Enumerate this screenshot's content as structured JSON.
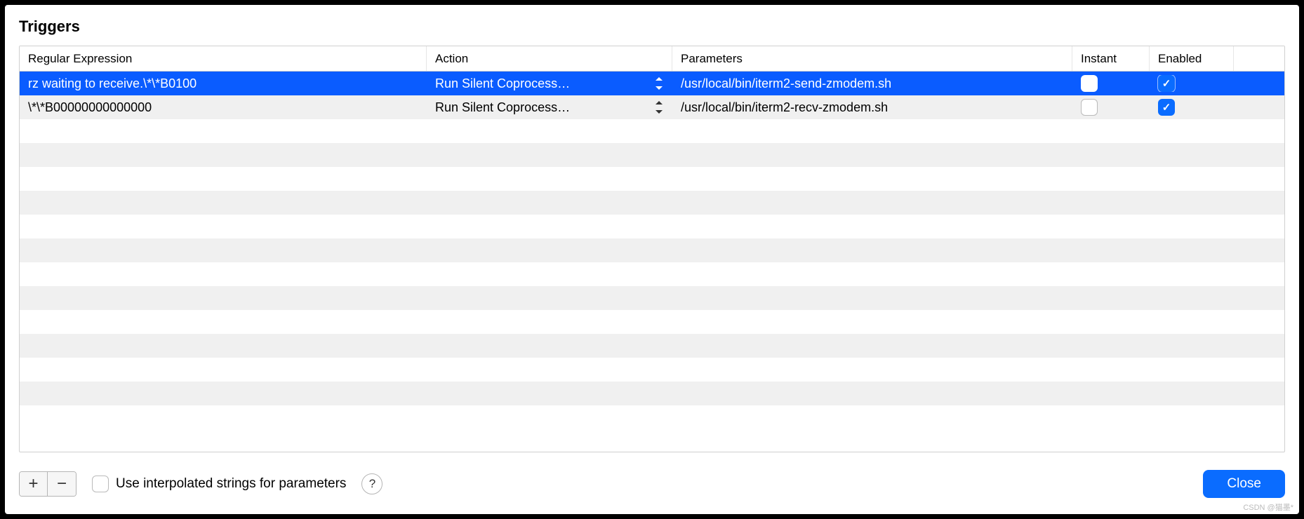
{
  "title": "Triggers",
  "columns": {
    "regex": "Regular Expression",
    "action": "Action",
    "params": "Parameters",
    "instant": "Instant",
    "enabled": "Enabled"
  },
  "rows": [
    {
      "regex": "rz waiting to receive.\\*\\*B0100",
      "action": "Run Silent Coprocess…",
      "params": "/usr/local/bin/iterm2-send-zmodem.sh",
      "instant": false,
      "enabled": true,
      "selected": true
    },
    {
      "regex": "\\*\\*B00000000000000",
      "action": "Run Silent Coprocess…",
      "params": "/usr/local/bin/iterm2-recv-zmodem.sh",
      "instant": false,
      "enabled": true,
      "selected": false
    }
  ],
  "empty_row_count": 12,
  "footer": {
    "add_label": "+",
    "remove_label": "−",
    "interpolated_label": "Use interpolated strings for parameters",
    "interpolated_checked": false,
    "help_label": "?",
    "close_label": "Close"
  },
  "watermark": "CSDN @猫墨*"
}
